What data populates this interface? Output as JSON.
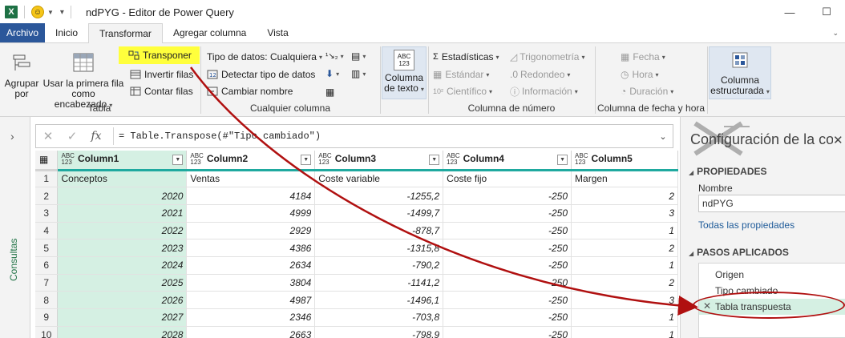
{
  "window": {
    "title": "ndPYG - Editor de Power Query",
    "app_badge": "X",
    "minimize": "—",
    "maximize": "☐"
  },
  "tabs": {
    "file": "Archivo",
    "items": [
      "Inicio",
      "Transformar",
      "Agregar columna",
      "Vista"
    ],
    "active": "Transformar"
  },
  "ribbon": {
    "tabla": {
      "label": "Tabla",
      "group_by": "Agrupar\npor",
      "first_row": "Usar la primera fila\ncomo encabezado",
      "transpose": "Transponer",
      "reverse_rows": "Invertir filas",
      "count_rows": "Contar filas"
    },
    "any_column": {
      "label": "Cualquier columna",
      "data_type": "Tipo de datos: Cualquiera",
      "detect_type": "Detectar tipo de datos",
      "rename": "Cambiar nombre"
    },
    "text_column": {
      "label": "Columna\nde texto",
      "icon_text": "ABC\n123"
    },
    "number_column": {
      "label": "Columna de número",
      "statistics": "Estadísticas",
      "standard": "Estándar",
      "scientific": "Científico",
      "trigonometry": "Trigonometría",
      "rounding": "Redondeo",
      "information": "Información",
      "sci_prefix": "10²"
    },
    "datetime_column": {
      "label": "Columna de fecha y hora",
      "date": "Fecha",
      "time": "Hora",
      "duration": "Duración"
    },
    "structured_column": {
      "label": "Columna\nestructurada"
    }
  },
  "leftnav": {
    "label": "Consultas",
    "chevron": "›"
  },
  "formula_bar": {
    "cancel": "✕",
    "confirm": "✓",
    "fx": "fx",
    "formula": "= Table.Transpose(#\"Tipo cambiado\")",
    "expand": "⌄"
  },
  "grid": {
    "type_badge": "ABC\n123",
    "columns": [
      "Column1",
      "Column2",
      "Column3",
      "Column4",
      "Column5"
    ],
    "rows": [
      {
        "n": "1",
        "cells": [
          "Conceptos",
          "Ventas",
          "Coste variable",
          "Coste fijo",
          "Margen"
        ]
      },
      {
        "n": "2",
        "cells": [
          "2020",
          "4184",
          "-1255,2",
          "-250",
          "2"
        ]
      },
      {
        "n": "3",
        "cells": [
          "2021",
          "4999",
          "-1499,7",
          "-250",
          "3"
        ]
      },
      {
        "n": "4",
        "cells": [
          "2022",
          "2929",
          "-878,7",
          "-250",
          "1"
        ]
      },
      {
        "n": "5",
        "cells": [
          "2023",
          "4386",
          "-1315,8",
          "-250",
          "2"
        ]
      },
      {
        "n": "6",
        "cells": [
          "2024",
          "2634",
          "-790,2",
          "-250",
          "1"
        ]
      },
      {
        "n": "7",
        "cells": [
          "2025",
          "3804",
          "-1141,2",
          "-250",
          "2"
        ]
      },
      {
        "n": "8",
        "cells": [
          "2026",
          "4987",
          "-1496,1",
          "-250",
          "3"
        ]
      },
      {
        "n": "9",
        "cells": [
          "2027",
          "2346",
          "-703,8",
          "-250",
          "1"
        ]
      },
      {
        "n": "10",
        "cells": [
          "2028",
          "2663",
          "-798,9",
          "-250",
          "1"
        ]
      }
    ]
  },
  "query_settings": {
    "title": "Configuración de la consulta",
    "close": "✕",
    "properties_header": "PROPIEDADES",
    "name_label": "Nombre",
    "name_value": "ndPYG",
    "all_properties": "Todas las propiedades",
    "applied_steps_header": "PASOS APLICADOS",
    "steps": [
      "Origen",
      "Tipo cambiado",
      "Tabla transpuesta"
    ],
    "active_step": "Tabla transpuesta",
    "step_delete": "✕",
    "collapse_marker": "◢"
  },
  "colors": {
    "accent_green": "#217346",
    "selected_col": "#d5f0e3",
    "header_rule": "#1fa99f",
    "highlight": "#ffff3c",
    "annotation": "#b01010",
    "file_tab": "#2b579a"
  }
}
